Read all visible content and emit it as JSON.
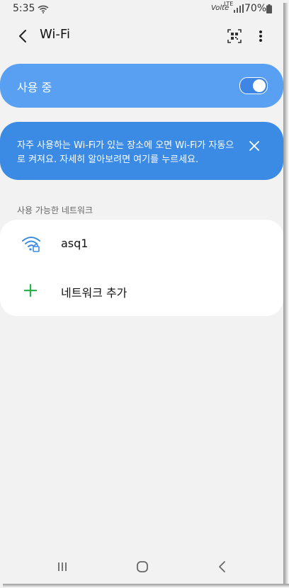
{
  "status_bar": {
    "time": "5:35",
    "volte": "Volte",
    "lte": "LTE",
    "battery": "70%"
  },
  "app_bar": {
    "title": "Wi-Fi"
  },
  "toggle": {
    "label": "사용 중",
    "state": "on"
  },
  "banner": {
    "text": "자주 사용하는 Wi-Fi가 있는 장소에 오면 Wi-Fi가 자동으로 켜져요. 자세히 알아보려면 여기를 누르세요."
  },
  "section": {
    "header": "사용 가능한 네트워크"
  },
  "networks": [
    {
      "label": "asq1",
      "icon": "wifi-lock-icon"
    },
    {
      "label": "네트워크 추가",
      "icon": "plus-icon"
    }
  ],
  "colors": {
    "accent": "#3b8ae3",
    "toggle_bg": "#5aa0f2",
    "plus": "#2bb24c"
  }
}
